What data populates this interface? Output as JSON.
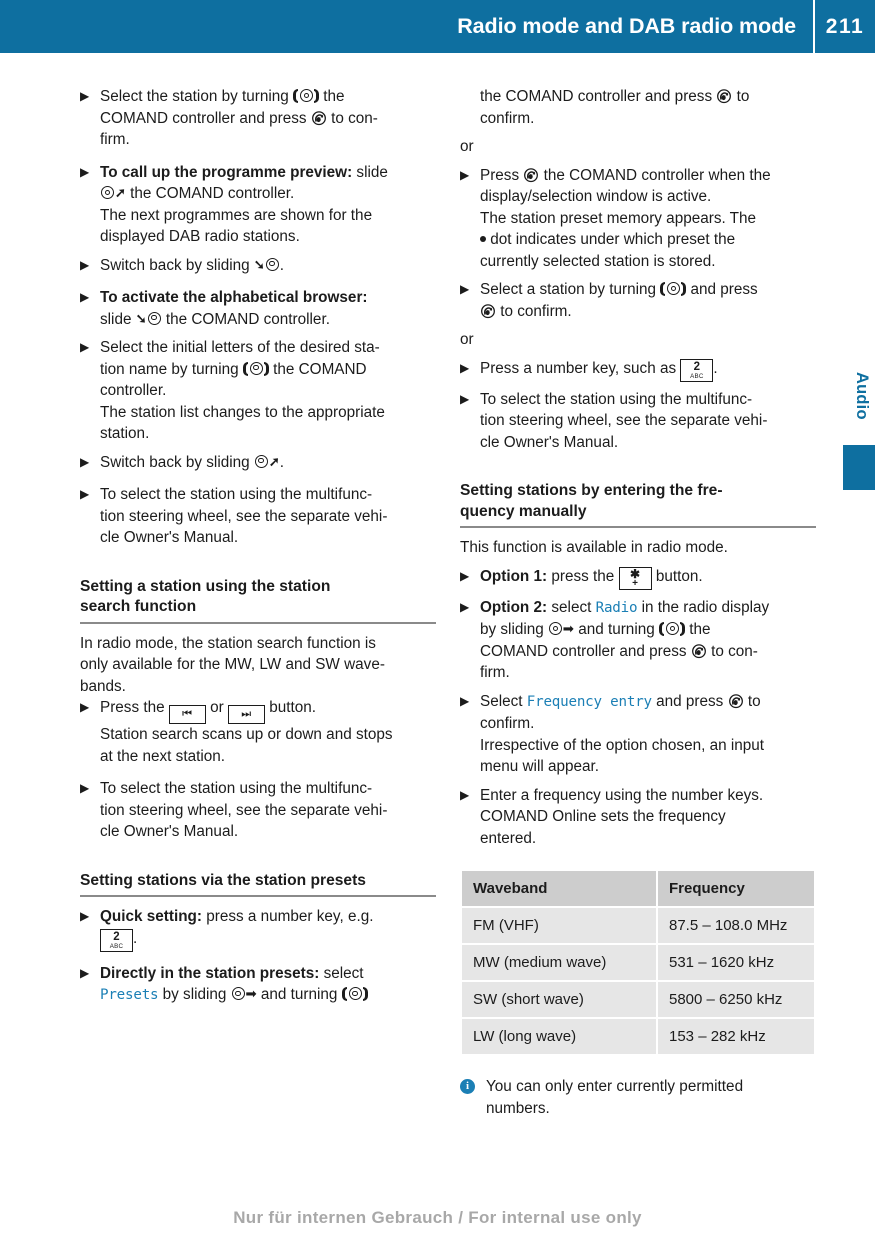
{
  "header": {
    "title": "Radio mode and DAB radio mode",
    "page_number": "211",
    "background_color": "#0e6fa0"
  },
  "side_tab": {
    "label": "Audio",
    "color": "#0e6fa0"
  },
  "icons": {
    "turn_controller": "comand-turn-icon",
    "press_controller": "comand-press-icon",
    "slide_right": "comand-slide-right-icon",
    "slide_left": "comand-slide-left-icon",
    "slide_down": "comand-slide-down-icon",
    "skip_back_key": "skip-back-key-icon",
    "skip_forward_key": "skip-forward-key-icon",
    "number_key_2": "number-key-2-abc-icon",
    "star_plus_key": "star-plus-key-icon",
    "info": "info-icon"
  },
  "left_column": {
    "step1": {
      "l1_a": "Select the station by turning",
      "l1_b": "the",
      "l2_a": "COMAND controller and press",
      "l2_b": "to con-",
      "l3": "firm."
    },
    "step2": {
      "bold": "To call up the programme preview:",
      "after_bold": "slide",
      "l2": "the COMAND controller.",
      "result1": "The next programmes are shown for the",
      "result2": "displayed DAB radio stations."
    },
    "step3": {
      "text_before": "Switch back by sliding",
      "text_after": "."
    },
    "step4": {
      "bold": "To activate the alphabetical browser:",
      "l2_a": "slide",
      "l2_b": "the COMAND controller."
    },
    "step5": {
      "l1": "Select the initial letters of the desired sta-",
      "l2_a": "tion name by turning",
      "l2_b": "the COMAND",
      "l3": "controller.",
      "result1": "The station list changes to the appropriate",
      "result2": "station."
    },
    "step6": {
      "text_before": "Switch back by sliding",
      "text_after": "."
    },
    "step7": {
      "l1": "To select the station using the multifunc-",
      "l2": "tion steering wheel, see the separate vehi-",
      "l3": "cle Owner's Manual."
    },
    "heading1": {
      "line1": "Setting a station using the station",
      "line2": "search function"
    },
    "intro": {
      "l1": "In radio mode, the station search function is",
      "l2": "only available for the MW, LW and SW wave-",
      "l3": "bands."
    },
    "step8": {
      "a": "Press the",
      "b": "or",
      "c": "button.",
      "result1": "Station search scans up or down and stops",
      "result2": "at the next station."
    },
    "step9": {
      "l1": "To select the station using the multifunc-",
      "l2": "tion steering wheel, see the separate vehi-",
      "l3": "cle Owner's Manual."
    },
    "heading2": "Setting stations via the station presets",
    "step10": {
      "bold": "Quick setting:",
      "after_bold": "press a number key, e.g.",
      "l2_after_key": "."
    },
    "step11": {
      "bold": "Directly in the station presets:",
      "after_bold": "select",
      "display": "Presets",
      "mid": "by sliding",
      "mid2": "and turning"
    }
  },
  "right_column": {
    "cont1": {
      "l1_a": "the COMAND controller and press",
      "l1_b": "to",
      "l2": "confirm."
    },
    "or1": "or",
    "step1": {
      "a": "Press",
      "b": "the COMAND controller when the",
      "l2": "display/selection window is active.",
      "result1": "The station preset memory appears. The",
      "result2": "dot indicates under which preset the",
      "result3": "currently selected station is stored."
    },
    "step2": {
      "l1_a": "Select a station by turning",
      "l1_b": "and press",
      "l2": "to confirm."
    },
    "or2": "or",
    "step3": {
      "a": "Press a number key, such as",
      "b": "."
    },
    "step4": {
      "l1": "To select the station using the multifunc-",
      "l2": "tion steering wheel, see the separate vehi-",
      "l3": "cle Owner's Manual."
    },
    "heading1": {
      "line1": "Setting stations by entering the fre-",
      "line2": "quency manually"
    },
    "intro": "This function is available in radio mode.",
    "step5": {
      "bold": "Option 1:",
      "after_bold": "press the",
      "after_key": "button."
    },
    "step6": {
      "bold": "Option 2:",
      "after_bold": "select",
      "display": "Radio",
      "after_display": "in the radio display",
      "l2_a": "by sliding",
      "l2_b": "and turning",
      "l2_c": "the",
      "l3_a": "COMAND controller and press",
      "l3_b": "to con-",
      "l4": "firm."
    },
    "step7": {
      "a": "Select",
      "display": "Frequency entry",
      "b": "and press",
      "c": "to",
      "l2": "confirm.",
      "result1": "Irrespective of the option chosen, an input",
      "result2": "menu will appear."
    },
    "step8": {
      "l1": "Enter a frequency using the number keys.",
      "result1": "COMAND Online sets the frequency",
      "result2": "entered."
    },
    "table": {
      "columns": [
        "Waveband",
        "Frequency"
      ],
      "rows": [
        [
          "FM (VHF)",
          "87.5 – 108.0 MHz"
        ],
        [
          "MW (medium wave)",
          "531 – 1620 kHz"
        ],
        [
          "SW (short wave)",
          "5800 – 6250 kHz"
        ],
        [
          "LW (long wave)",
          "153 – 282 kHz"
        ]
      ]
    },
    "note": {
      "icon_letter": "i",
      "l1": "You can only enter currently permitted",
      "l2": "numbers."
    }
  },
  "footer": {
    "watermark": "Nur für internen Gebrauch / For internal use only"
  }
}
